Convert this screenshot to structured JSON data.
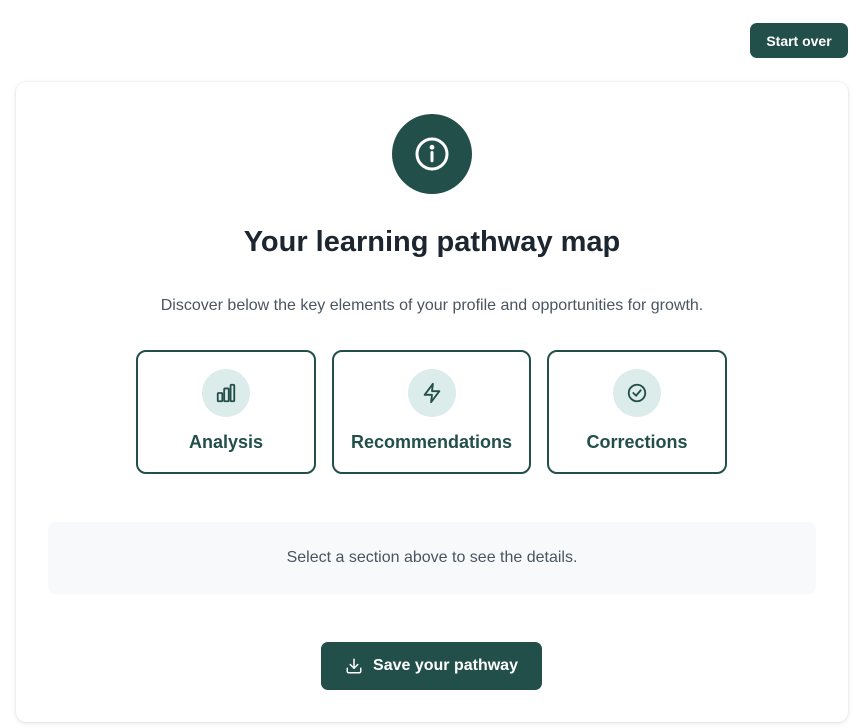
{
  "header": {
    "start_over_label": "Start over"
  },
  "hero": {
    "icon": "info-icon",
    "title": "Your learning pathway map",
    "subtitle": "Discover below the key elements of your profile and opportunities for growth."
  },
  "sections": [
    {
      "label": "Analysis",
      "icon": "bar-chart-icon"
    },
    {
      "label": "Recommendations",
      "icon": "lightning-icon"
    },
    {
      "label": "Corrections",
      "icon": "check-circle-icon"
    }
  ],
  "detail": {
    "placeholder": "Select a section above to see the details."
  },
  "footer": {
    "save_label": "Save your pathway",
    "save_icon": "download-icon"
  },
  "colors": {
    "primary": "#234f4a",
    "icon_bg": "#dceceb",
    "panel_bg": "#f7f9fa"
  }
}
